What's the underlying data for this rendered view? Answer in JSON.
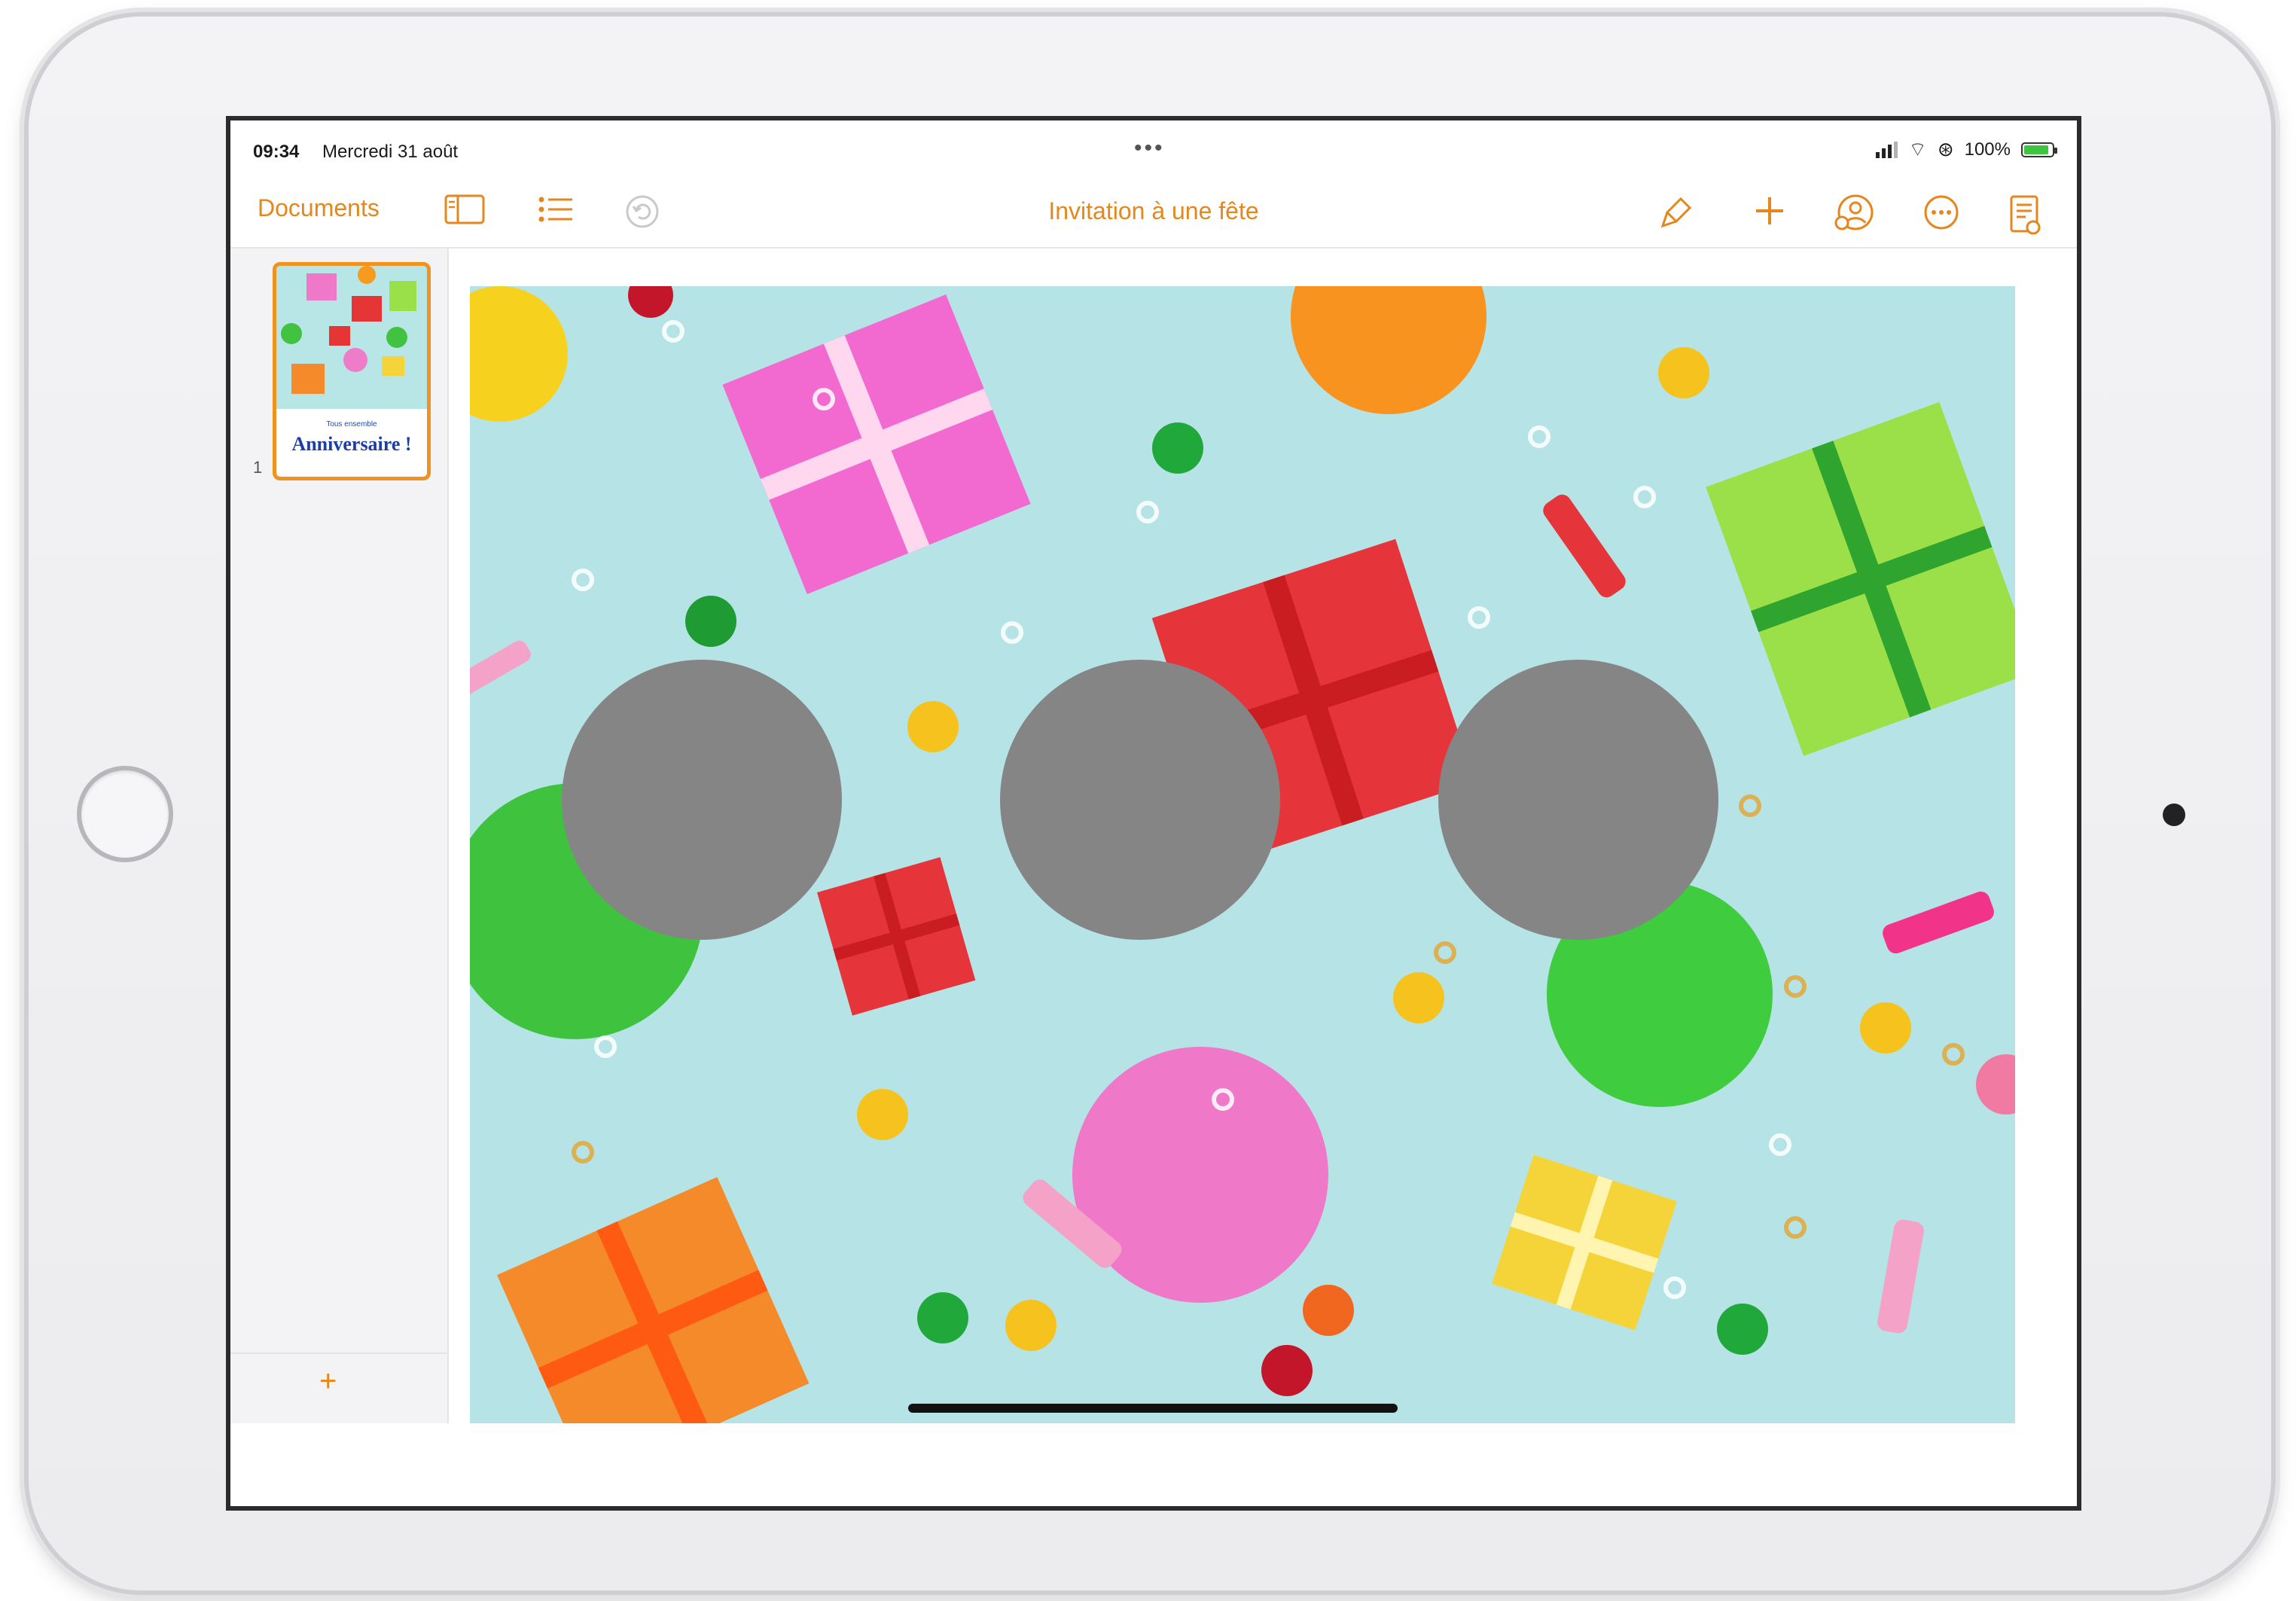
{
  "status_bar": {
    "time": "09:34",
    "date": "Mercredi 31 août",
    "multitask": "•••",
    "battery": "100%"
  },
  "toolbar": {
    "documents_label": "Documents",
    "title": "Invitation à une fête",
    "icons": [
      "sidebar-icon",
      "list-icon",
      "undo-icon",
      "format-brush-icon",
      "plus-icon",
      "collaborate-icon",
      "more-icon",
      "document-setup-icon"
    ]
  },
  "sidebar": {
    "thumbnail_small_text": "Tous ensemble",
    "thumbnail_title": "Anniversaire !",
    "page_number": "1",
    "add_page": "+"
  },
  "colors": {
    "accent": "#e5871c",
    "image_background": "#b6e3e5",
    "overlay_circle": "#858585"
  }
}
